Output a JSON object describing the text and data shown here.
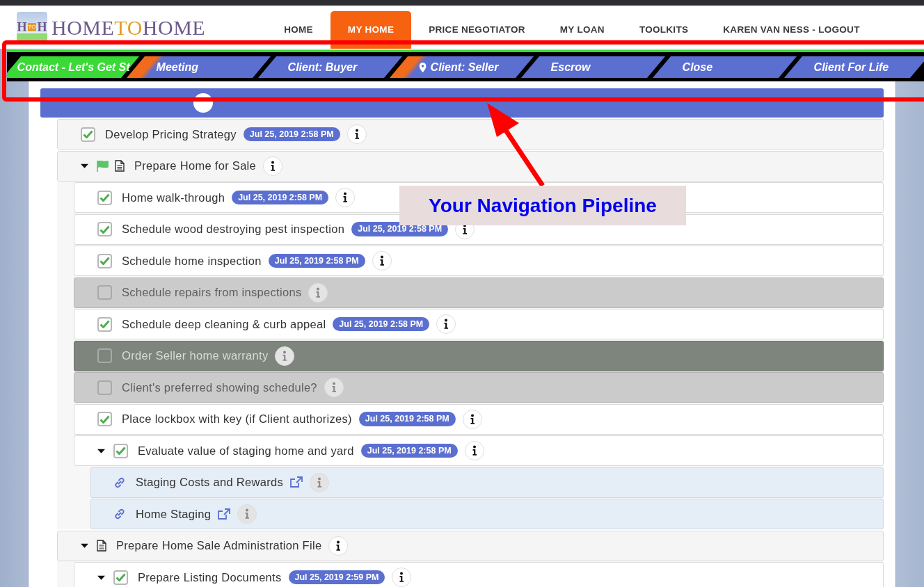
{
  "logo": {
    "icon_text": [
      "H",
      "TO",
      "H"
    ],
    "parts": [
      "HOME",
      "TO",
      "HOME"
    ]
  },
  "nav": [
    {
      "label": "HOME",
      "selected": false
    },
    {
      "label": "MY HOME",
      "selected": true
    },
    {
      "label": "PRICE NEGOTIATOR",
      "selected": false
    },
    {
      "label": "MY LOAN",
      "selected": false
    },
    {
      "label": "TOOLKITS",
      "selected": false
    },
    {
      "label": "KAREN VAN NESS - LOGOUT",
      "selected": false
    }
  ],
  "pipeline": [
    {
      "label": "Contact - Let's Get St",
      "done": true,
      "visited": false,
      "selected": false
    },
    {
      "label": "Meeting",
      "done": false,
      "visited": true,
      "selected": false
    },
    {
      "label": "Client: Buyer",
      "done": false,
      "visited": false,
      "selected": false
    },
    {
      "label": "Client: Seller",
      "done": false,
      "visited": true,
      "selected": true
    },
    {
      "label": "Escrow",
      "done": false,
      "visited": false,
      "selected": false
    },
    {
      "label": "Close",
      "done": false,
      "visited": false,
      "selected": false
    },
    {
      "label": "Client For Life",
      "done": false,
      "visited": false,
      "selected": false
    }
  ],
  "tasks": [
    {
      "kind": "task",
      "label": "Develop Pricing Strategy",
      "checked": true,
      "disabled": false,
      "skipped": false,
      "date": "Jul 25, 2019 2:58 PM"
    },
    {
      "kind": "section",
      "label": "Prepare Home for Sale",
      "flag": true,
      "expanded": true,
      "children": [
        {
          "kind": "task",
          "label": "Home walk-through",
          "checked": true,
          "disabled": false,
          "skipped": false,
          "date": "Jul 25, 2019 2:58 PM"
        },
        {
          "kind": "task",
          "label": "Schedule wood destroying pest inspection",
          "checked": true,
          "disabled": false,
          "skipped": false,
          "date": "Jul 25, 2019 2:58 PM"
        },
        {
          "kind": "task",
          "label": "Schedule home inspection",
          "checked": true,
          "disabled": false,
          "skipped": false,
          "date": "Jul 25, 2019 2:58 PM"
        },
        {
          "kind": "task",
          "label": "Schedule repairs from inspections",
          "checked": false,
          "disabled": true,
          "skipped": false
        },
        {
          "kind": "task",
          "label": "Schedule deep cleaning & curb appeal",
          "checked": true,
          "disabled": false,
          "skipped": false,
          "date": "Jul 25, 2019 2:58 PM"
        },
        {
          "kind": "task",
          "label": "Order Seller home warranty",
          "checked": false,
          "disabled": false,
          "skipped": true
        },
        {
          "kind": "task",
          "label": "Client's preferred showing schedule?",
          "checked": false,
          "disabled": true,
          "skipped": false
        },
        {
          "kind": "task",
          "label": "Place lockbox with key (if Client authorizes)",
          "checked": true,
          "disabled": false,
          "skipped": false,
          "date": "Jul 25, 2019 2:58 PM"
        },
        {
          "kind": "task",
          "label": "Evaluate value of staging home and yard",
          "checked": true,
          "expanded": true,
          "disabled": false,
          "skipped": false,
          "date": "Jul 25, 2019 2:58 PM",
          "children": [
            {
              "kind": "link",
              "label": "Staging Costs and Rewards"
            },
            {
              "kind": "link",
              "label": "Home Staging"
            }
          ]
        }
      ]
    },
    {
      "kind": "section",
      "label": "Prepare Home Sale Administration File",
      "flag": false,
      "expanded": true,
      "children": [
        {
          "kind": "task",
          "label": "Prepare Listing Documents",
          "checked": true,
          "expanded": true,
          "disabled": false,
          "skipped": false,
          "date": "Jul 25, 2019 2:59 PM"
        }
      ]
    }
  ],
  "annotation": {
    "label": "Your Navigation Pipeline"
  }
}
